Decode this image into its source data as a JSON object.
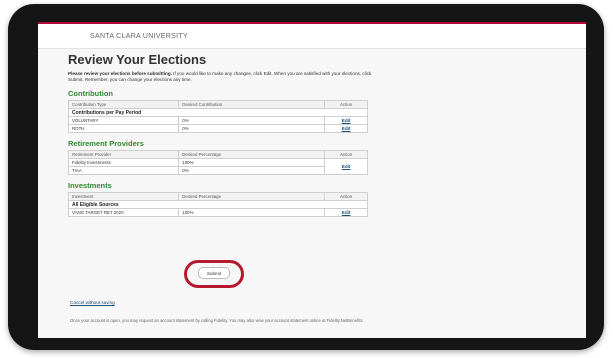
{
  "header": {
    "brand": "SANTA CLARA UNIVERSITY"
  },
  "page": {
    "title": "Review Your Elections",
    "intro_bold": "Please review your elections before submitting.",
    "intro_rest": " If you would like to make any changes, click Edit. When you are satisfied with your elections, click Submit. Remember, you can change your elections any time."
  },
  "contribution": {
    "title": "Contribution",
    "columns": [
      "Contribution Type",
      "Desired Contribution",
      "Action"
    ],
    "subheading": "Contributions per Pay Period",
    "rows": [
      {
        "type": "VOLUNTARY",
        "value": "0%",
        "action": "Edit"
      },
      {
        "type": "ROTH",
        "value": "0%",
        "action": "Edit"
      }
    ]
  },
  "retirement": {
    "title": "Retirement Providers",
    "columns": [
      "Retirement Provider",
      "Desired Percentage",
      "Action"
    ],
    "rows": [
      {
        "provider": "Fidelity Investments",
        "value": "100%"
      },
      {
        "provider": "TIAA",
        "value": "0%"
      }
    ],
    "action": "Edit"
  },
  "investments": {
    "title": "Investments",
    "columns": [
      "Investment",
      "Desired Percentage",
      "Action"
    ],
    "subheading": "All Eligible Sources",
    "rows": [
      {
        "fund": "VANG TARGET RET 2020",
        "value": "100%",
        "action": "Edit"
      }
    ]
  },
  "actions": {
    "submit": "Submit",
    "cancel": "Cancel without saving"
  },
  "footer": {
    "text": "Once your account is open, you may request an account statement by calling Fidelity. You may also view your account statement online at Fidelity.NetBenefits."
  },
  "colors": {
    "brand_red": "#b30738",
    "section_green": "#2f8a2e",
    "highlight_ring": "#b51a2f",
    "link_blue": "#1f4f7a"
  }
}
